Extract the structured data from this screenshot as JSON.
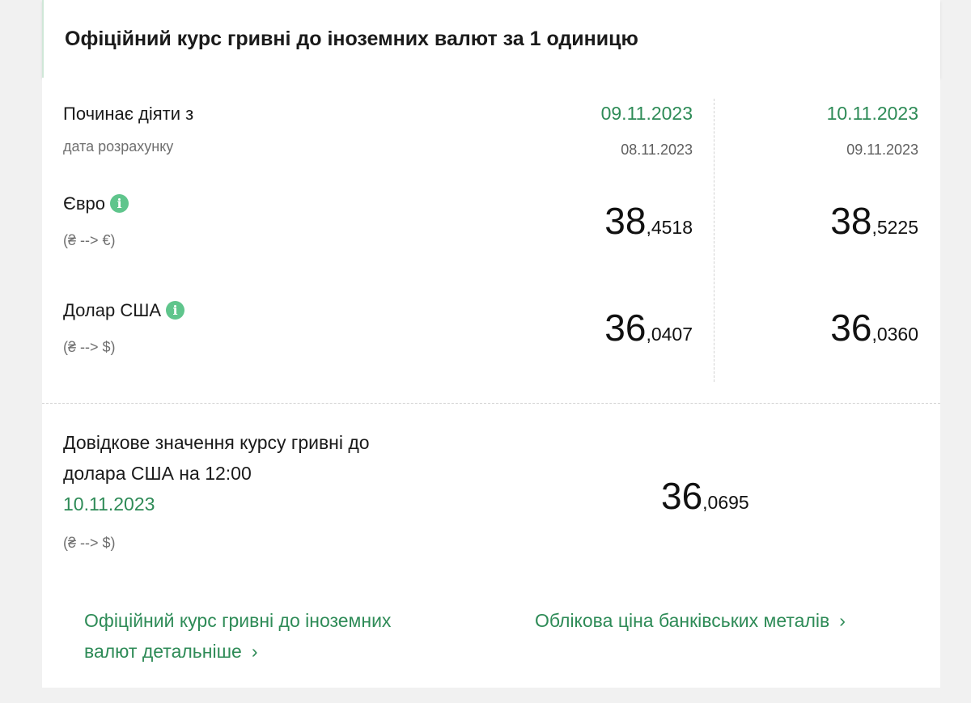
{
  "header": {
    "title": "Офіційний курс гривні до іноземних валют за 1 одиницю"
  },
  "rates": {
    "effective_label": "Починає діяти з",
    "calc_label": "дата розрахунку",
    "columns": [
      {
        "effective_date": "09.11.2023",
        "calc_date": "08.11.2023"
      },
      {
        "effective_date": "10.11.2023",
        "calc_date": "09.11.2023"
      }
    ],
    "currencies": [
      {
        "name": "Євро",
        "direction": "(₴ --> €)",
        "values": [
          {
            "int": "38",
            "frac": ",4518"
          },
          {
            "int": "38",
            "frac": ",5225"
          }
        ]
      },
      {
        "name": "Долар США",
        "direction": "(₴ --> $)",
        "values": [
          {
            "int": "36",
            "frac": ",0407"
          },
          {
            "int": "36",
            "frac": ",0360"
          }
        ]
      }
    ]
  },
  "reference": {
    "label_line1": "Довідкове значення курсу гривні до",
    "label_line2": "долара США на 12:00",
    "date": "10.11.2023",
    "direction": "(₴ --> $)",
    "value_int": "36",
    "value_frac": ",0695"
  },
  "links": {
    "official_line1": "Офіційний курс гривні до іноземних",
    "official_line2": "валют детальніше",
    "metals": "Облікова ціна банківських металів",
    "chevron": "›"
  },
  "colors": {
    "accent_green": "#2e8b57",
    "info_icon": "#5fc58c"
  },
  "icons": {
    "info": "info-icon",
    "chevron": "chevron-right-icon"
  }
}
